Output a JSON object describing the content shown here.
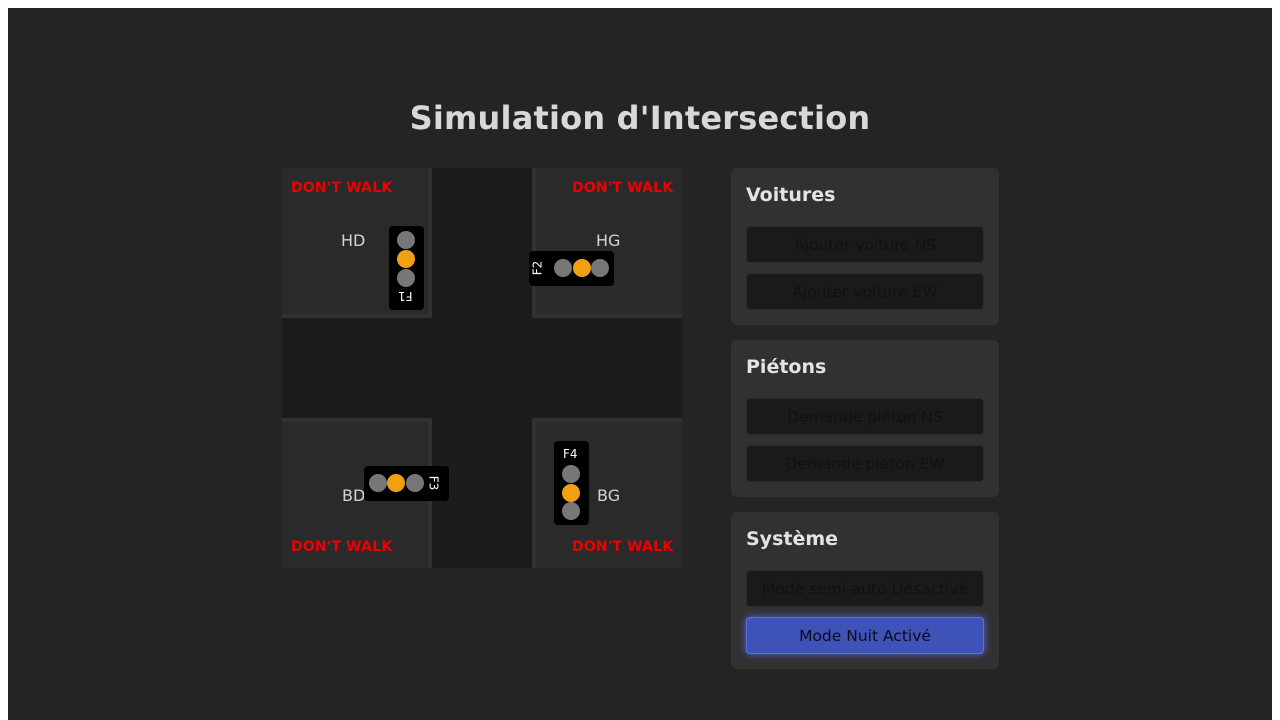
{
  "app": {
    "title": "Simulation d'Intersection"
  },
  "intersection": {
    "crosswalk_signals": {
      "top_left": "DON'T WALK",
      "top_right": "DON'T WALK",
      "bottom_left": "DON'T WALK",
      "bottom_right": "DON'T WALK"
    },
    "corners": {
      "top_left": "HD",
      "top_right": "HG",
      "bottom_left": "BD",
      "bottom_right": "BG"
    },
    "traffic_lights": [
      {
        "label": "F1",
        "active": "yellow"
      },
      {
        "label": "F2",
        "active": "yellow"
      },
      {
        "label": "F3",
        "active": "yellow"
      },
      {
        "label": "F4",
        "active": "yellow"
      }
    ],
    "colors": {
      "lamp_off": "#777777",
      "lamp_yellow": "#f0a010",
      "dont_walk": "#ee0000"
    }
  },
  "panels": {
    "cars": {
      "title": "Voitures",
      "add_ns": "Ajouter voiture NS",
      "add_ew": "Ajouter voiture EW"
    },
    "pedestrians": {
      "title": "Piétons",
      "request_ns": "Demande piéton NS",
      "request_ew": "Demande piéton EW"
    },
    "system": {
      "title": "Système",
      "semi_auto": "Mode semi-auto Désactivé",
      "night_mode": "Mode Nuit Activé"
    }
  },
  "accent_color": "#3f52b8"
}
